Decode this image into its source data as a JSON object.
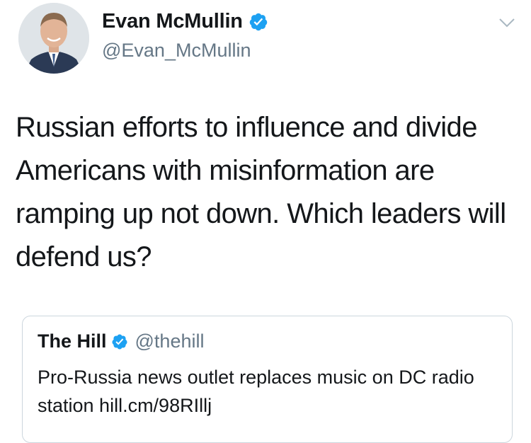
{
  "tweet": {
    "author_name": "Evan McMullin",
    "author_handle": "@Evan_McMullin",
    "text": "Russian efforts to influence and divide Americans with misinformation are ramping up not down. Which leaders will defend us?"
  },
  "quoted_tweet": {
    "author_name": "The Hill",
    "author_handle": "@thehill",
    "text": "Pro-Russia news outlet replaces music on DC radio station hill.cm/98RIllj"
  },
  "icons": {
    "verified": "verified-badge-icon",
    "caret": "chevron-down-icon"
  },
  "colors": {
    "verified_blue": "#1da1f2",
    "secondary_text": "#657786",
    "primary_text": "#14171a",
    "card_border": "#ccd6dd"
  }
}
